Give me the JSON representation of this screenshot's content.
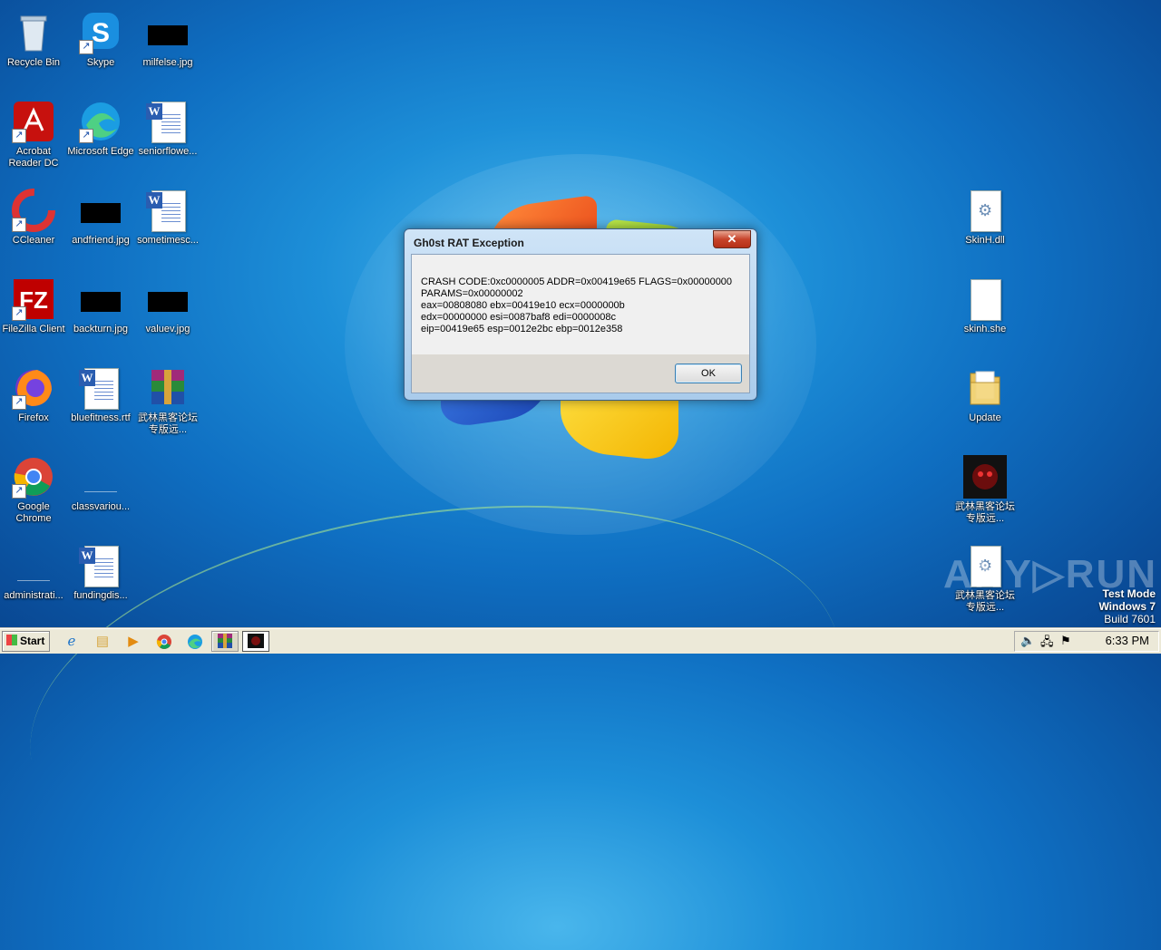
{
  "desktop": {
    "icons_left": [
      {
        "label": "Recycle Bin",
        "icon": "recycle-bin-icon"
      },
      {
        "label": "Skype",
        "icon": "skype-icon"
      },
      {
        "label": "milfelse.jpg",
        "icon": "image-file-icon"
      },
      {
        "label": "Acrobat Reader DC",
        "icon": "acrobat-icon"
      },
      {
        "label": "Microsoft Edge",
        "icon": "edge-icon"
      },
      {
        "label": "seniorflowe...",
        "icon": "word-doc-icon"
      },
      {
        "label": "CCleaner",
        "icon": "ccleaner-icon"
      },
      {
        "label": "andfriend.jpg",
        "icon": "image-file-icon"
      },
      {
        "label": "sometimesc...",
        "icon": "word-doc-icon"
      },
      {
        "label": "FileZilla Client",
        "icon": "filezilla-icon"
      },
      {
        "label": "backturn.jpg",
        "icon": "image-file-icon"
      },
      {
        "label": "valuev.jpg",
        "icon": "image-file-icon"
      },
      {
        "label": "Firefox",
        "icon": "firefox-icon"
      },
      {
        "label": "bluefitness.rtf",
        "icon": "word-doc-icon"
      },
      {
        "label": "武林黑客论坛专版远...",
        "icon": "winrar-icon"
      },
      {
        "label": "Google Chrome",
        "icon": "chrome-icon"
      },
      {
        "label": "classvariou...",
        "icon": "blank-file-icon"
      },
      {
        "label": "administrati...",
        "icon": "blank-file-icon"
      },
      {
        "label": "fundingdis...",
        "icon": "word-doc-icon"
      }
    ],
    "icons_right": [
      {
        "label": "SkinH.dll",
        "icon": "dll-file-icon"
      },
      {
        "label": "skinh.she",
        "icon": "blank-file-icon"
      },
      {
        "label": "Update",
        "icon": "folder-icon"
      },
      {
        "label": "武林黑客论坛专版远...",
        "icon": "app-exe-icon"
      },
      {
        "label": "武林黑客论坛专版远...",
        "icon": "dll-file-icon"
      }
    ]
  },
  "dialog": {
    "title": "Gh0st RAT Exception",
    "close_glyph": "✕",
    "message": "CRASH CODE:0xc0000005 ADDR=0x00419e65 FLAGS=0x00000000\nPARAMS=0x00000002\neax=00808080 ebx=00419e10 ecx=0000000b\nedx=00000000 esi=0087baf8 edi=0000008c\neip=00419e65 esp=0012e2bc ebp=0012e358",
    "ok_label": "OK"
  },
  "watermark": {
    "text": "ANY▷RUN"
  },
  "test_mode": {
    "line1": "Test Mode",
    "line2": "Windows 7",
    "line3": "Build 7601"
  },
  "taskbar": {
    "start_label": "Start",
    "clock": "6:33 PM",
    "quick_launch": [
      "ie-icon",
      "explorer-icon",
      "media-player-icon",
      "chrome-icon",
      "edge-icon"
    ],
    "tasks": [
      "winrar-task",
      "ghost-rat-task"
    ]
  }
}
